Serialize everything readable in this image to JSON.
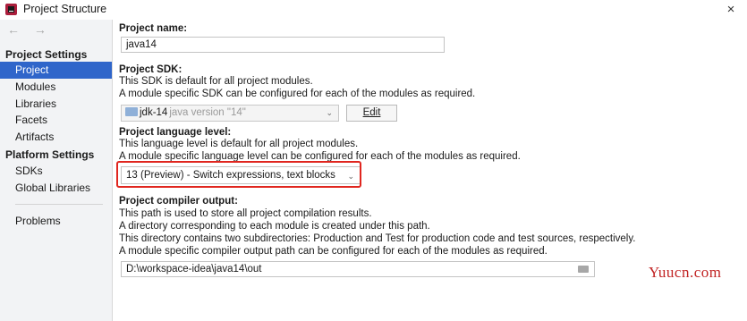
{
  "window": {
    "title": "Project Structure",
    "close": "×"
  },
  "sidebar": {
    "back": "←",
    "forward": "→",
    "project_settings_header": "Project Settings",
    "project_items": [
      "Project",
      "Modules",
      "Libraries",
      "Facets",
      "Artifacts"
    ],
    "platform_settings_header": "Platform Settings",
    "platform_items": [
      "SDKs",
      "Global Libraries"
    ],
    "problems": "Problems",
    "selected": "Project"
  },
  "main": {
    "name_label": "Project name:",
    "name_value": "java14",
    "sdk_label": "Project SDK:",
    "sdk_desc1": "This SDK is default for all project modules.",
    "sdk_desc2": "A module specific SDK can be configured for each of the modules as required.",
    "sdk_name": "jdk-14",
    "sdk_version": "java version \"14\"",
    "edit_button": "Edit",
    "lang_label": "Project language level:",
    "lang_desc1": "This language level is default for all project modules.",
    "lang_desc2": "A module specific language level can be configured for each of the modules as required.",
    "lang_value": "13 (Preview) - Switch expressions, text blocks",
    "output_label": "Project compiler output:",
    "output_desc1": "This path is used to store all project compilation results.",
    "output_desc2": "A directory corresponding to each module is created under this path.",
    "output_desc3": "This directory contains two subdirectories: Production and Test for production code and test sources, respectively.",
    "output_desc4": "A module specific compiler output path can be configured for each of the modules as required.",
    "output_value": "D:\\workspace-idea\\java14\\out"
  },
  "watermark": "Yuucn.com",
  "colors": {
    "selection": "#2f65ca",
    "highlight_border": "#e0261f",
    "watermark": "#c12424"
  }
}
